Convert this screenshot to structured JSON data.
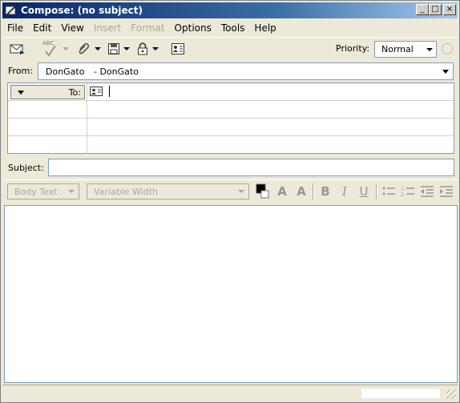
{
  "window": {
    "title": "Compose: (no subject)",
    "minimize_glyph": "_",
    "maximize_glyph": "□",
    "close_glyph": "×"
  },
  "menu": {
    "items": [
      {
        "label": "File",
        "enabled": true
      },
      {
        "label": "Edit",
        "enabled": true
      },
      {
        "label": "View",
        "enabled": true
      },
      {
        "label": "Insert",
        "enabled": false
      },
      {
        "label": "Format",
        "enabled": false
      },
      {
        "label": "Options",
        "enabled": true
      },
      {
        "label": "Tools",
        "enabled": true
      },
      {
        "label": "Help",
        "enabled": true
      }
    ]
  },
  "toolbar": {
    "icons": [
      "send-icon",
      "spell-check-icon",
      "attach-icon",
      "save-icon",
      "security-lock-icon",
      "address-book-icon"
    ],
    "spell_abc": "ABC",
    "priority_label": "Priority:",
    "priority_value": "Normal"
  },
  "from": {
    "label": "From:",
    "name": "DonGato",
    "account": "- DonGato"
  },
  "addressing": {
    "type_label": "To:",
    "recipient_value": ""
  },
  "subject": {
    "label": "Subject:",
    "value": ""
  },
  "format": {
    "paragraph_style": "Body Text",
    "font_family": "Variable Width",
    "text_color": "#000000",
    "bold_glyph": "B",
    "italic_glyph": "I",
    "underline_glyph": "U",
    "larger_glyph": "A",
    "smaller_glyph": "A"
  },
  "colors": {
    "title_start": "#0a246a",
    "title_end": "#a6caf0",
    "chrome": "#ece9d8",
    "disabled_text": "#aca899"
  }
}
